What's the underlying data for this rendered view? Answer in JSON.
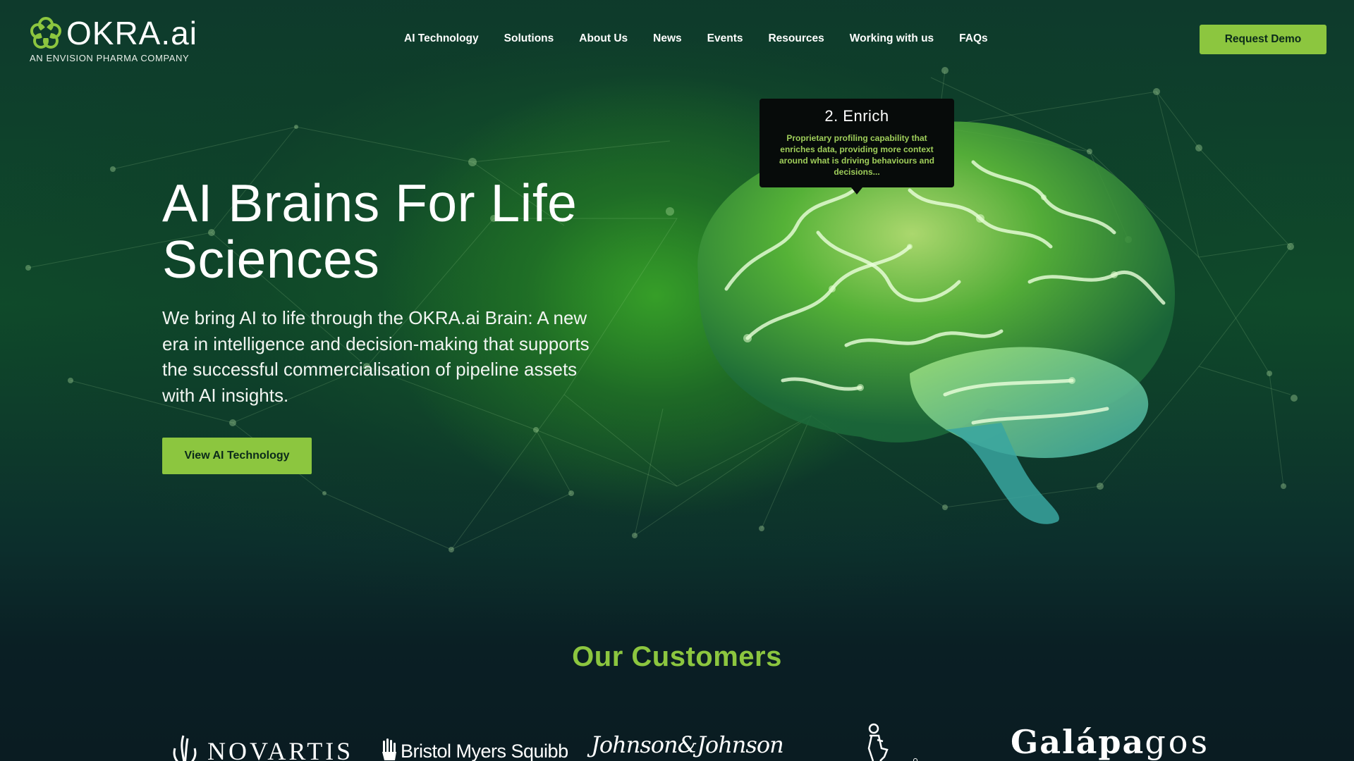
{
  "header": {
    "logo_text": "OKRA.ai",
    "logo_subtitle": "AN ENVISION PHARMA COMPANY",
    "nav": [
      {
        "label": "AI Technology"
      },
      {
        "label": "Solutions"
      },
      {
        "label": "About Us"
      },
      {
        "label": "News"
      },
      {
        "label": "Events"
      },
      {
        "label": "Resources"
      },
      {
        "label": "Working with us"
      },
      {
        "label": "FAQs"
      }
    ],
    "request_demo_label": "Request Demo"
  },
  "hero": {
    "title_line1": "AI Brains For Life",
    "title_line2": "Sciences",
    "description": "We bring AI to life through the OKRA.ai Brain: A new era in intelligence and decision-making that supports the successful commercialisation of pipeline assets with AI insights.",
    "cta_label": "View AI Technology"
  },
  "tooltip": {
    "title": "2. Enrich",
    "body": "Proprietary profiling capability that enriches data, providing more context around what is driving behaviours and decisions..."
  },
  "customers": {
    "heading": "Our Customers",
    "logos": [
      {
        "name": "NOVARTIS"
      },
      {
        "name": "Bristol Myers Squibb"
      },
      {
        "name": "Johnson&Johnson"
      },
      {
        "name": "bayer-logo"
      },
      {
        "name_bold": "Galápa",
        "name_light": "gos"
      }
    ]
  },
  "colors": {
    "accent": "#8cc63f",
    "background": "#0a1f22",
    "tooltip_text": "#9fce5a"
  }
}
